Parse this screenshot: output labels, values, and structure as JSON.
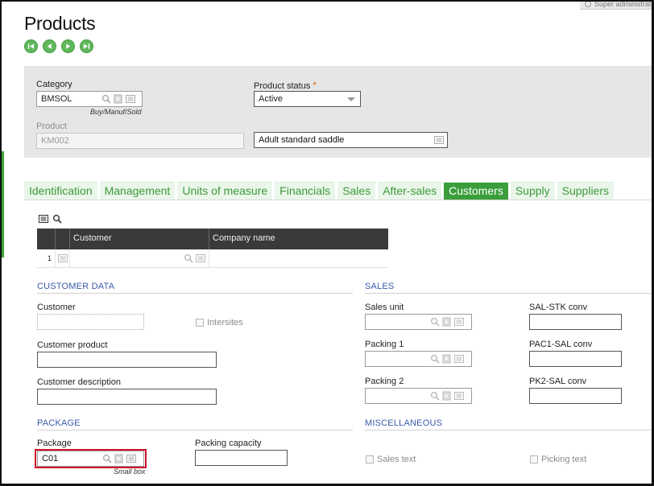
{
  "user": {
    "label": "Super administrator"
  },
  "page": {
    "title": "Products"
  },
  "nav": {
    "first": "first-record",
    "prev": "previous-record",
    "next": "next-record",
    "last": "last-record"
  },
  "header": {
    "category": {
      "label": "Category",
      "value": "BMSOL",
      "sublabel": "Buy/Manuf/Sold"
    },
    "product_status": {
      "label": "Product status",
      "required_mark": "*",
      "value": "Active"
    },
    "product": {
      "label": "Product",
      "value": "KM002"
    },
    "description": {
      "value": "Adult standard saddle"
    }
  },
  "tabs": [
    {
      "label": "Identification",
      "active": false
    },
    {
      "label": "Management",
      "active": false
    },
    {
      "label": "Units of measure",
      "active": false
    },
    {
      "label": "Financials",
      "active": false
    },
    {
      "label": "Sales",
      "active": false
    },
    {
      "label": "After-sales",
      "active": false
    },
    {
      "label": "Customers",
      "active": true
    },
    {
      "label": "Supply",
      "active": false
    },
    {
      "label": "Suppliers",
      "active": false
    }
  ],
  "grid": {
    "columns": [
      "Customer",
      "Company name"
    ],
    "rows": [
      {
        "num": "1",
        "customer": "",
        "company": ""
      }
    ]
  },
  "customer_data": {
    "section": "CUSTOMER DATA",
    "customer": {
      "label": "Customer",
      "value": ""
    },
    "intersites": {
      "label": "Intersites",
      "checked": false
    },
    "customer_product": {
      "label": "Customer product",
      "value": ""
    },
    "customer_description": {
      "label": "Customer description",
      "value": ""
    }
  },
  "sales": {
    "section": "SALES",
    "sales_unit": {
      "label": "Sales unit",
      "value": ""
    },
    "sal_stk_conv": {
      "label": "SAL-STK conv",
      "value": ""
    },
    "packing1": {
      "label": "Packing 1",
      "value": ""
    },
    "pac1_sal_conv": {
      "label": "PAC1-SAL conv",
      "value": ""
    },
    "packing2": {
      "label": "Packing 2",
      "value": ""
    },
    "pk2_sal_conv": {
      "label": "PK2-SAL conv",
      "value": ""
    }
  },
  "package": {
    "section": "PACKAGE",
    "package": {
      "label": "Package",
      "value": "C01",
      "sublabel": "Small box"
    },
    "packing_capacity": {
      "label": "Packing capacity",
      "value": ""
    }
  },
  "misc": {
    "section": "MISCELLANEOUS",
    "sales_text": {
      "label": "Sales text",
      "checked": false
    },
    "picking_text": {
      "label": "Picking text",
      "checked": false
    }
  },
  "colors": {
    "accent": "#3a9e3a",
    "section": "#3a5aa8",
    "highlight": "#d0152a",
    "required": "#e26a1a"
  }
}
